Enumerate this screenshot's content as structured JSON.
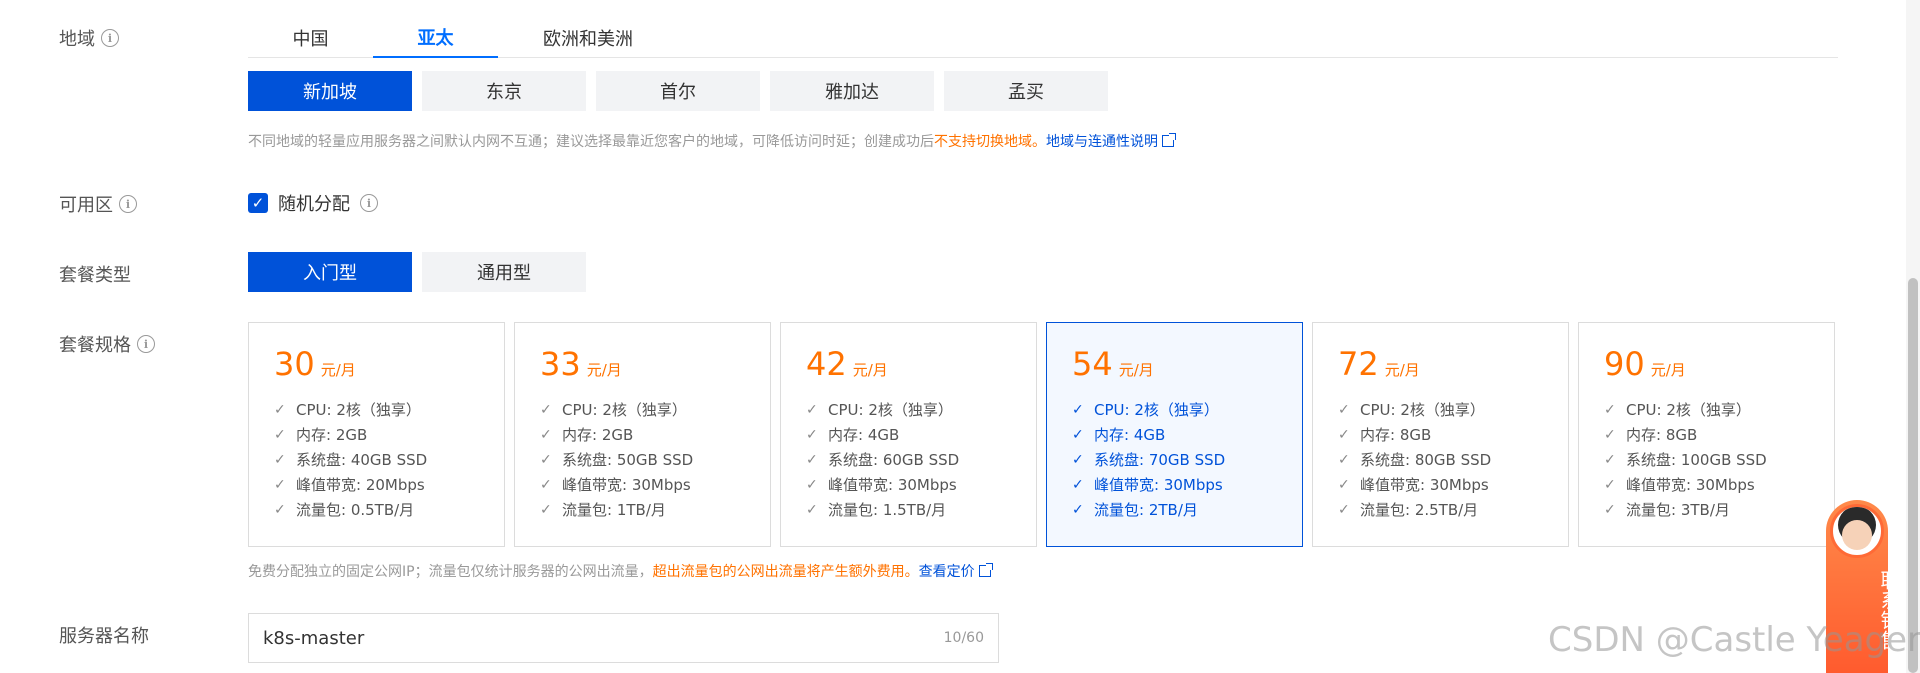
{
  "region": {
    "label": "地域",
    "tabs": [
      "中国",
      "亚太",
      "欧洲和美洲"
    ],
    "cities": [
      "新加坡",
      "东京",
      "首尔",
      "雅加达",
      "孟买"
    ],
    "hint_prefix": "不同地域的轻量应用服务器之间默认内网不互通；建议选择最靠近您客户的地域，可降低访问时延；创建成功后",
    "hint_warn": "不支持切换地域。",
    "hint_link": "地域与连通性说明"
  },
  "zone": {
    "label": "可用区",
    "checkbox_label": "随机分配"
  },
  "plan_type": {
    "label": "套餐类型",
    "options": [
      "入门型",
      "通用型"
    ]
  },
  "plan_spec": {
    "label": "套餐规格",
    "unit": "元/月",
    "cards": [
      {
        "price": "30",
        "specs": [
          "CPU: 2核（独享）",
          "内存: 2GB",
          "系统盘: 40GB SSD",
          "峰值带宽: 20Mbps",
          "流量包: 0.5TB/月"
        ]
      },
      {
        "price": "33",
        "specs": [
          "CPU: 2核（独享）",
          "内存: 2GB",
          "系统盘: 50GB SSD",
          "峰值带宽: 30Mbps",
          "流量包: 1TB/月"
        ]
      },
      {
        "price": "42",
        "specs": [
          "CPU: 2核（独享）",
          "内存: 4GB",
          "系统盘: 60GB SSD",
          "峰值带宽: 30Mbps",
          "流量包: 1.5TB/月"
        ]
      },
      {
        "price": "54",
        "specs": [
          "CPU: 2核（独享）",
          "内存: 4GB",
          "系统盘: 70GB SSD",
          "峰值带宽: 30Mbps",
          "流量包: 2TB/月"
        ]
      },
      {
        "price": "72",
        "specs": [
          "CPU: 2核（独享）",
          "内存: 8GB",
          "系统盘: 80GB SSD",
          "峰值带宽: 30Mbps",
          "流量包: 2.5TB/月"
        ]
      },
      {
        "price": "90",
        "specs": [
          "CPU: 2核（独享）",
          "内存: 8GB",
          "系统盘: 100GB SSD",
          "峰值带宽: 30Mbps",
          "流量包: 3TB/月"
        ]
      }
    ],
    "hint_prefix": "免费分配独立的固定公网IP；流量包仅统计服务器的公网出流量，",
    "hint_warn": "超出流量包的公网出流量将产生额外费用。",
    "hint_link": "查看定价"
  },
  "server_name": {
    "label": "服务器名称",
    "value": "k8s-master",
    "counter": "10/60"
  },
  "contact": {
    "text": "联系销售"
  },
  "watermark": "CSDN @Castle Yeager",
  "colors": {
    "primary": "#0052d9",
    "tab_active": "#006eff",
    "price": "#ff7200"
  }
}
